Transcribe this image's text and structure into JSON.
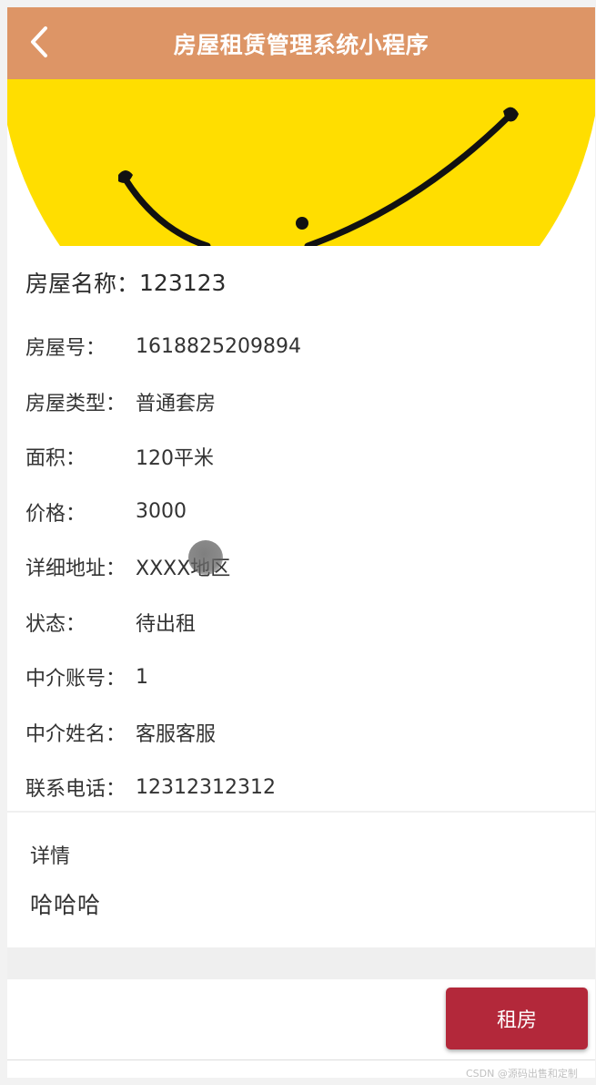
{
  "header": {
    "title": "房屋租赁管理系统小程序",
    "back_icon": "chevron-left-icon"
  },
  "house": {
    "name_label": "房屋名称：",
    "name_value": "123123",
    "fields": [
      {
        "label": "房屋号：",
        "value": "1618825209894"
      },
      {
        "label": "房屋类型：",
        "value": "普通套房"
      },
      {
        "label": "面积：",
        "value": "120平米"
      },
      {
        "label": "价格：",
        "value": "3000"
      },
      {
        "label": "详细地址：",
        "value": "XXXX地区"
      },
      {
        "label": "状态：",
        "value": "待出租"
      },
      {
        "label": "中介账号：",
        "value": "1"
      },
      {
        "label": "中介姓名：",
        "value": "客服客服"
      },
      {
        "label": "联系电话：",
        "value": "12312312312"
      }
    ]
  },
  "detail": {
    "title": "详情",
    "content": "哈哈哈"
  },
  "actions": {
    "rent_label": "租房"
  },
  "colors": {
    "header_bg": "#dd9566",
    "banner_yellow": "#ffde00",
    "rent_button": "#b3283a"
  },
  "watermark": "CSDN @源码出售和定制"
}
